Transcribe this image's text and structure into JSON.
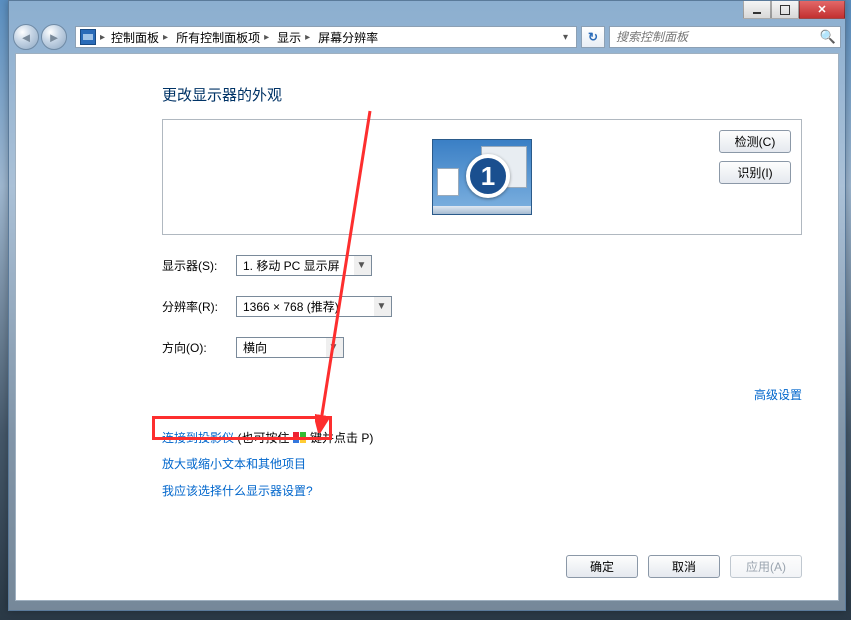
{
  "breadcrumbs": {
    "root_arrow": "▸",
    "item1": "控制面板",
    "item2": "所有控制面板项",
    "item3": "显示",
    "item4": "屏幕分辨率"
  },
  "search": {
    "placeholder": "搜索控制面板"
  },
  "page": {
    "title": "更改显示器的外观",
    "detect_btn": "检测(C)",
    "identify_btn": "识别(I)",
    "monitor_number": "1"
  },
  "form": {
    "display_label": "显示器(S):",
    "display_value": "1. 移动 PC 显示屏",
    "resolution_label": "分辨率(R):",
    "resolution_value": "1366 × 768 (推荐)",
    "orientation_label": "方向(O):",
    "orientation_value": "横向"
  },
  "links": {
    "advanced": "高级设置",
    "projector_prefix": "连接到投影仪",
    "projector_hint": " (也可按住 ",
    "projector_hint_tail": " 键并点击 P)",
    "text_size": "放大或缩小文本和其他项目",
    "which_settings": "我应该选择什么显示器设置?"
  },
  "footer": {
    "ok": "确定",
    "cancel": "取消",
    "apply": "应用(A)"
  }
}
